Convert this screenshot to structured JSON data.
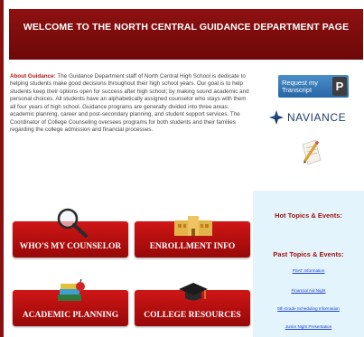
{
  "banner": {
    "title": "WELCOME TO THE NORTH CENTRAL GUIDANCE DEPARTMENT PAGE"
  },
  "intro": {
    "lead": "About Guidance:",
    "body": " The Guidance Department staff of North Central High School is dedicate to helping students make good decisions throughout their high school years. Our goal is to help students keep their options open for success after high school; by making sound academic and personal choices.  All students have an alphabetically assigned counselor who stays with them all four years of high school.  Guidance programs are generally divided into three areas:  academic planning, career and post-secondary planning, and student support services.  The Coordinator of College Counseling oversees programs for both students and their families regarding the college admission and financial processes."
  },
  "sidebar": {
    "request_transcript": "Request my Transcript",
    "parchment_letter": "P",
    "naviance": "NAVIANCE"
  },
  "buttons": {
    "counselor": "WHO'S MY COUNSELOR",
    "enrollment": "ENROLLMENT INFO",
    "academic": "ACADEMIC PLANNING",
    "college": "COLLEGE RESOURCES"
  },
  "events": {
    "hot_heading": "Hot Topics & Events:",
    "past_heading": "Past Topics & Events:",
    "links": [
      "PSAT Information",
      "Financial Aid Night",
      "9th Grade Scheduling Information",
      "Junior Night Presentation"
    ]
  },
  "colors": {
    "brand_red": "#8e1111",
    "button_red": "#c41212",
    "link_blue": "#1a3fc8",
    "panel_blue": "#e3f4fc"
  },
  "icons": [
    "magnifier-icon",
    "school-building-icon",
    "books-apple-icon",
    "graduation-cap-icon",
    "form-pencil-icon",
    "naviance-compass-icon"
  ]
}
